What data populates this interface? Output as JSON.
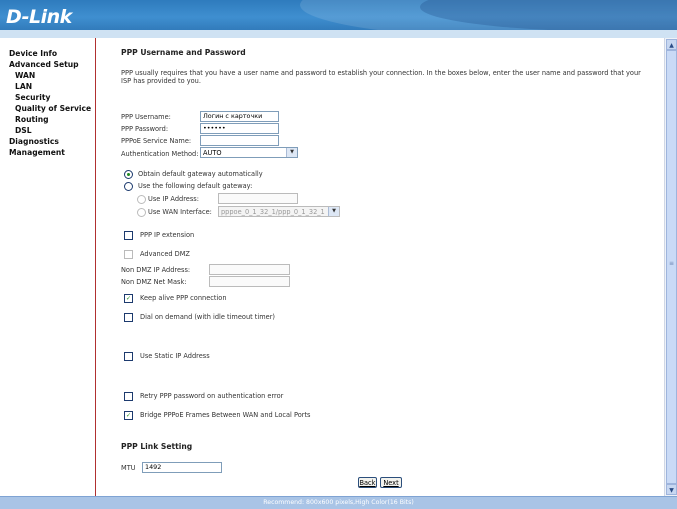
{
  "brand": {
    "logo": "D-Link"
  },
  "sidebar": {
    "items": [
      {
        "label": "Device Info",
        "level": 0
      },
      {
        "label": "Advanced Setup",
        "level": 0
      },
      {
        "label": "WAN",
        "level": 1
      },
      {
        "label": "LAN",
        "level": 1
      },
      {
        "label": "Security",
        "level": 1
      },
      {
        "label": "Quality of Service",
        "level": 1
      },
      {
        "label": "Routing",
        "level": 1
      },
      {
        "label": "DSL",
        "level": 1
      },
      {
        "label": "Diagnostics",
        "level": 0
      },
      {
        "label": "Management",
        "level": 0
      }
    ]
  },
  "main": {
    "title": "PPP Username and Password",
    "description": "PPP usually requires that you have a user name and password to establish your connection. In the boxes below, enter the user name and password that your ISP has provided to you.",
    "username": {
      "label": "PPP Username:",
      "value": "Логин с карточки"
    },
    "password": {
      "label": "PPP Password:",
      "value": "••••••"
    },
    "service_name": {
      "label": "PPPoE Service Name:",
      "value": ""
    },
    "auth": {
      "label": "Authentication Method:",
      "value": "AUTO"
    },
    "gateway": {
      "auto_label": "Obtain default gateway automatically",
      "manual_label": "Use the following default gateway:",
      "ip_label": "Use IP Address:",
      "ip_value": "",
      "wan_label": "Use WAN Interface:",
      "wan_value": "pppoe_0_1_32_1/ppp_0_1_32_1"
    },
    "ppp_ip_extension": {
      "label": "PPP IP extension",
      "checked": false
    },
    "advanced_dmz": {
      "label": "Advanced DMZ",
      "checked": false
    },
    "non_dmz_ip": {
      "label": "Non DMZ IP Address:",
      "value": ""
    },
    "non_dmz_mask": {
      "label": "Non DMZ Net Mask:",
      "value": ""
    },
    "keep_alive": {
      "label": "Keep alive PPP connection",
      "checked": true
    },
    "dial_on_demand": {
      "label": "Dial on demand (with idle timeout timer)",
      "checked": false
    },
    "static_ip": {
      "label": "Use Static IP Address",
      "checked": false
    },
    "retry_password": {
      "label": "Retry PPP password on authentication error",
      "checked": false
    },
    "bridge_pppoe": {
      "label": "Bridge PPPoE Frames Between WAN and Local Ports",
      "checked": true
    },
    "link_title": "PPP Link Setting",
    "mtu": {
      "label": "MTU",
      "value": "1492"
    },
    "back_label": "Back",
    "next_label": "Next"
  },
  "icons": {
    "check": "checkmark-icon",
    "arrow": "chevron-down-icon",
    "scroll_up": "scroll-up-icon",
    "scroll_down": "scroll-down-icon"
  },
  "footer": {
    "text": "Recommend: 800x600 pixels,High Color(16 Bits)"
  },
  "colors": {
    "header": "#2e7bbd",
    "footer": "#a9c4e6",
    "sidebar_border": "#b03030",
    "check": "#1f8a1f"
  }
}
